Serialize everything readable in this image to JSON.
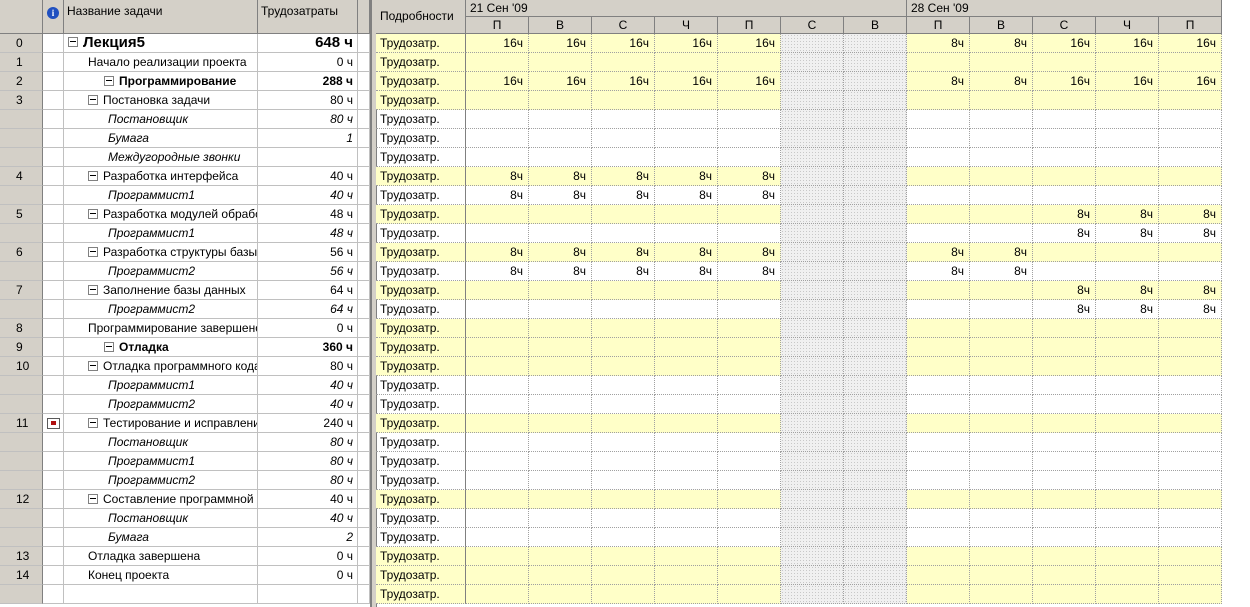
{
  "left_headers": {
    "info": "i",
    "name": "Название задачи",
    "work": "Трудозатраты"
  },
  "detail_header": "Подробности",
  "weeks": [
    "21 Сен '09",
    "28 Сен '09"
  ],
  "days": [
    "П",
    "В",
    "С",
    "Ч",
    "П",
    "С",
    "В",
    "П",
    "В",
    "С",
    "Ч",
    "П"
  ],
  "weekend_cols": [
    5,
    6
  ],
  "detail_label": "Трудозатр.",
  "rows": [
    {
      "id": "0",
      "name": "Лекция5",
      "work": "648 ч",
      "level": 0,
      "toggle": true,
      "values": [
        "16ч",
        "16ч",
        "16ч",
        "16ч",
        "16ч",
        "",
        "",
        "8ч",
        "8ч",
        "16ч",
        "16ч",
        "16ч"
      ]
    },
    {
      "id": "1",
      "name": "Начало реализации проекта",
      "work": "0 ч",
      "level": 2,
      "values": []
    },
    {
      "id": "2",
      "name": "Программирование",
      "work": "288 ч",
      "level": 1,
      "toggle": true,
      "values": [
        "16ч",
        "16ч",
        "16ч",
        "16ч",
        "16ч",
        "",
        "",
        "8ч",
        "8ч",
        "16ч",
        "16ч",
        "16ч"
      ]
    },
    {
      "id": "3",
      "name": "Постановка задачи",
      "work": "80 ч",
      "level": 2,
      "toggle": true,
      "values": []
    },
    {
      "id": "",
      "name": "Постановщик",
      "work": "80 ч",
      "level": 3,
      "resource": true,
      "values": []
    },
    {
      "id": "",
      "name": "Бумага",
      "work": "1",
      "level": 3,
      "resource": true,
      "values": []
    },
    {
      "id": "",
      "name": "Междугородные звонки",
      "work": "",
      "level": 3,
      "resource": true,
      "values": []
    },
    {
      "id": "4",
      "name": "Разработка интерфейса",
      "work": "40 ч",
      "level": 2,
      "toggle": true,
      "values": [
        "8ч",
        "8ч",
        "8ч",
        "8ч",
        "8ч"
      ]
    },
    {
      "id": "",
      "name": "Программист1",
      "work": "40 ч",
      "level": 3,
      "resource": true,
      "values": [
        "8ч",
        "8ч",
        "8ч",
        "8ч",
        "8ч"
      ]
    },
    {
      "id": "5",
      "name": "Разработка модулей обработки",
      "work": "48 ч",
      "level": 2,
      "toggle": true,
      "values": [
        "",
        "",
        "",
        "",
        "",
        "",
        "",
        "",
        "",
        "8ч",
        "8ч",
        "8ч"
      ]
    },
    {
      "id": "",
      "name": "Программист1",
      "work": "48 ч",
      "level": 3,
      "resource": true,
      "values": [
        "",
        "",
        "",
        "",
        "",
        "",
        "",
        "",
        "",
        "8ч",
        "8ч",
        "8ч"
      ]
    },
    {
      "id": "6",
      "name": "Разработка структуры базы",
      "work": "56 ч",
      "level": 2,
      "toggle": true,
      "values": [
        "8ч",
        "8ч",
        "8ч",
        "8ч",
        "8ч",
        "",
        "",
        "8ч",
        "8ч"
      ]
    },
    {
      "id": "",
      "name": "Программист2",
      "work": "56 ч",
      "level": 3,
      "resource": true,
      "values": [
        "8ч",
        "8ч",
        "8ч",
        "8ч",
        "8ч",
        "",
        "",
        "8ч",
        "8ч"
      ]
    },
    {
      "id": "7",
      "name": "Заполнение базы данных",
      "work": "64 ч",
      "level": 2,
      "toggle": true,
      "values": [
        "",
        "",
        "",
        "",
        "",
        "",
        "",
        "",
        "",
        "8ч",
        "8ч",
        "8ч"
      ]
    },
    {
      "id": "",
      "name": "Программист2",
      "work": "64 ч",
      "level": 3,
      "resource": true,
      "values": [
        "",
        "",
        "",
        "",
        "",
        "",
        "",
        "",
        "",
        "8ч",
        "8ч",
        "8ч"
      ]
    },
    {
      "id": "8",
      "name": "Программирование завершено",
      "work": "0 ч",
      "level": 2,
      "values": []
    },
    {
      "id": "9",
      "name": "Отладка",
      "work": "360 ч",
      "level": 1,
      "toggle": true,
      "values": []
    },
    {
      "id": "10",
      "name": "Отладка программного кода",
      "work": "80 ч",
      "level": 2,
      "toggle": true,
      "values": []
    },
    {
      "id": "",
      "name": "Программист1",
      "work": "40 ч",
      "level": 3,
      "resource": true,
      "values": []
    },
    {
      "id": "",
      "name": "Программист2",
      "work": "40 ч",
      "level": 3,
      "resource": true,
      "values": []
    },
    {
      "id": "11",
      "name": "Тестирование и исправление",
      "work": "240 ч",
      "level": 2,
      "toggle": true,
      "note": true,
      "values": []
    },
    {
      "id": "",
      "name": "Постановщик",
      "work": "80 ч",
      "level": 3,
      "resource": true,
      "values": []
    },
    {
      "id": "",
      "name": "Программист1",
      "work": "80 ч",
      "level": 3,
      "resource": true,
      "values": []
    },
    {
      "id": "",
      "name": "Программист2",
      "work": "80 ч",
      "level": 3,
      "resource": true,
      "values": []
    },
    {
      "id": "12",
      "name": "Составление программной документации",
      "work": "40 ч",
      "level": 2,
      "toggle": true,
      "values": []
    },
    {
      "id": "",
      "name": "Постановщик",
      "work": "40 ч",
      "level": 3,
      "resource": true,
      "values": []
    },
    {
      "id": "",
      "name": "Бумага",
      "work": "2",
      "level": 3,
      "resource": true,
      "values": []
    },
    {
      "id": "13",
      "name": "Отладка завершена",
      "work": "0 ч",
      "level": 2,
      "values": []
    },
    {
      "id": "14",
      "name": "Конец проекта",
      "work": "0 ч",
      "level": 2,
      "values": []
    },
    {
      "id": "",
      "name": "",
      "work": "",
      "level": 3,
      "values": []
    }
  ]
}
